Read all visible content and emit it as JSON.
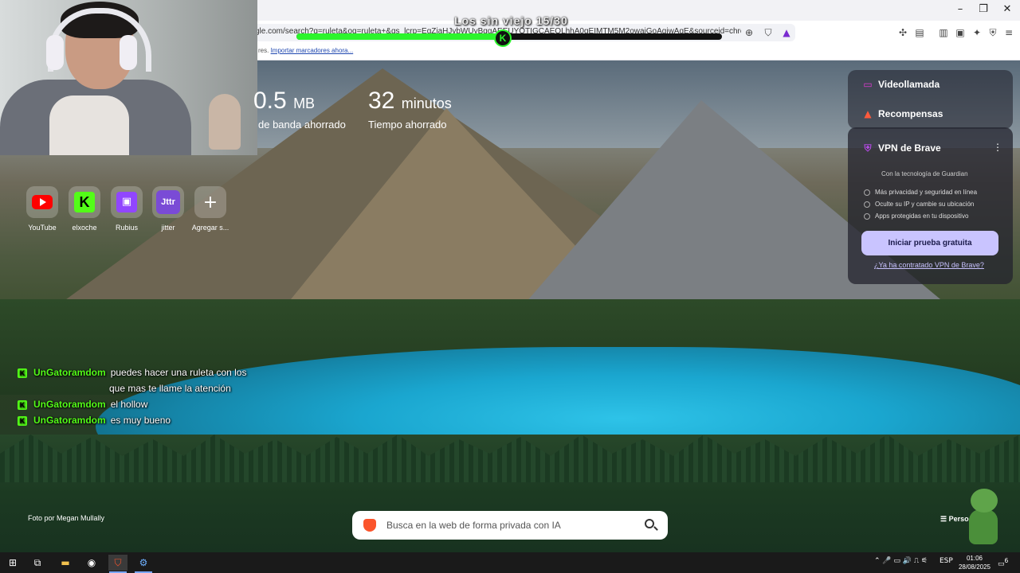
{
  "overlay": {
    "title": "Los sin viejo 15/30",
    "progress_fraction": 0.48,
    "knob_label": "K"
  },
  "browser": {
    "url": "gle.com/search?q=ruleta&oq=ruleta+&gs_lcrp=EgZjaHJvbWUyBggAEEUYOTIGCAEQLhhA0gEIMTM5M2owajGoAgiwAgE&sourceid=chrome&ie=...",
    "bookmarks_prefix": "res.",
    "bookmarks_link": "Importar marcadores ahora..."
  },
  "stats": {
    "bandwidth_value": "0.5",
    "bandwidth_unit": "MB",
    "bandwidth_label": "de banda ahorrado",
    "time_value": "32",
    "time_unit": "minutos",
    "time_label": "Tiempo ahorrado"
  },
  "top_sites": [
    {
      "label": "YouTube"
    },
    {
      "label": "elxoche"
    },
    {
      "label": "Rubius"
    },
    {
      "label": "jitter"
    },
    {
      "label": "Agregar s..."
    }
  ],
  "right_panel": {
    "videollamada": "Videollamada",
    "recompensas": "Recompensas",
    "vpn_title": "VPN de Brave",
    "vpn_powered": "Con la tecnología de  Guardian",
    "vpn_features": [
      "Más privacidad y seguridad en línea",
      "Oculte su IP y cambie su ubicación",
      "Apps protegidas en tu dispositivo"
    ],
    "vpn_button": "Iniciar prueba gratuita",
    "vpn_link": "¿Ya ha contratado VPN de Brave?"
  },
  "chat": [
    {
      "user": "UnGatoramdom",
      "message": "puedes hacer una ruleta con los"
    },
    {
      "user": "",
      "message": "que mas te llame la atención"
    },
    {
      "user": "UnGatoramdom",
      "message": "el hollow"
    },
    {
      "user": "UnGatoramdom",
      "message": "es muy bueno"
    }
  ],
  "photo_credit": "Foto por Megan Mullally",
  "search": {
    "placeholder": "Busca en la web de forma privada con IA"
  },
  "customize": "Perso",
  "taskbar": {
    "language": "ESP",
    "time": "01:06",
    "date": "28/08/2025",
    "notification_count": "6"
  },
  "colors": {
    "kick_green": "#53fc18",
    "brave_orange": "#fb542b",
    "vpn_button": "#c9c4ff"
  }
}
